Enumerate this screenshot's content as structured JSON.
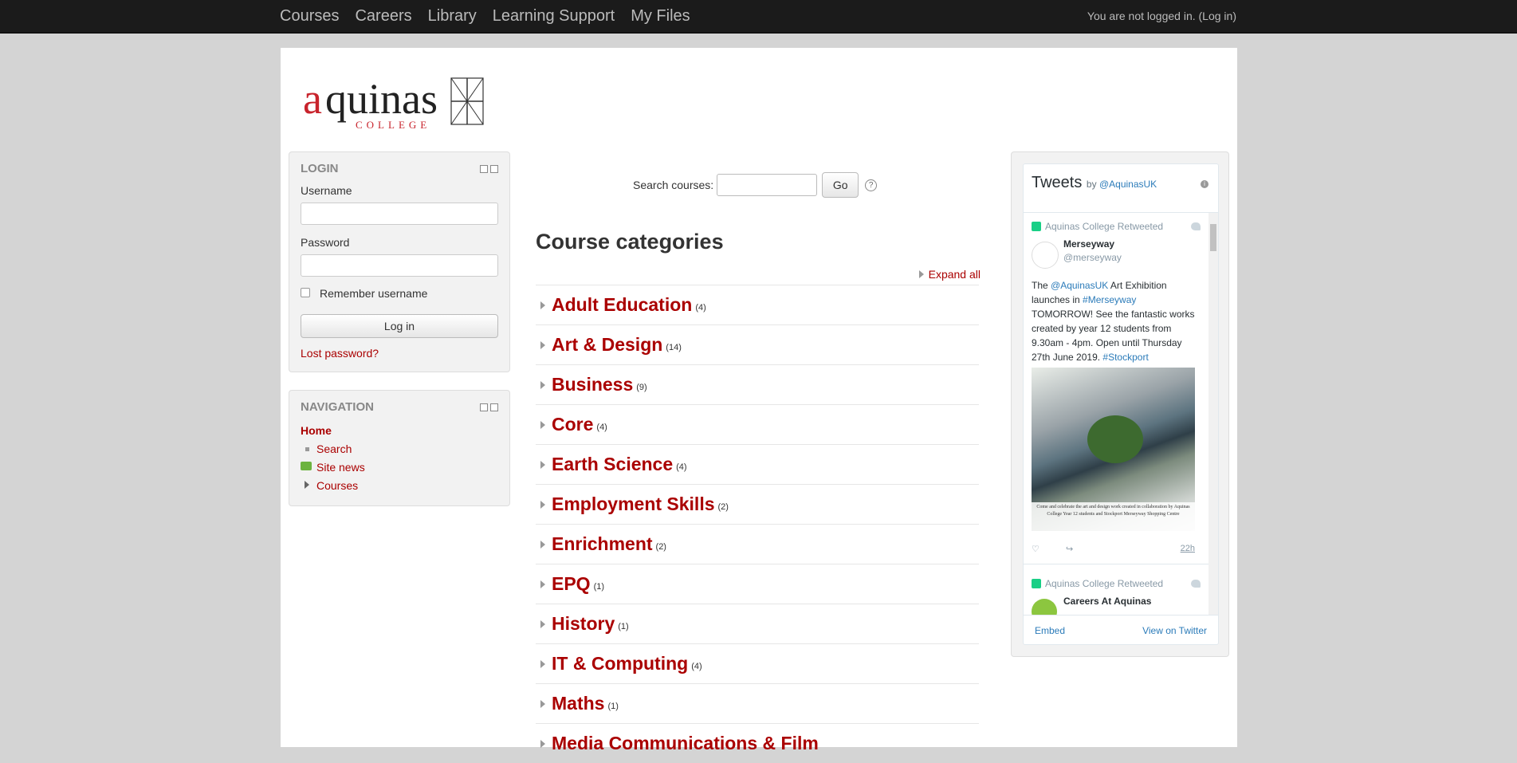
{
  "topnav": {
    "items": [
      "Courses",
      "Careers",
      "Library",
      "Learning Support",
      "My Files"
    ],
    "login_status": "You are not logged in. (Log in)"
  },
  "logo": {
    "brand": "aquinas",
    "sub": "COLLEGE"
  },
  "login_block": {
    "title": "LOGIN",
    "username_label": "Username",
    "password_label": "Password",
    "remember_label": "Remember username",
    "login_button": "Log in",
    "lost_password": "Lost password?"
  },
  "nav_block": {
    "title": "NAVIGATION",
    "home": "Home",
    "items": [
      "Search",
      "Site news",
      "Courses"
    ]
  },
  "search": {
    "label": "Search courses:",
    "go": "Go",
    "help": "?"
  },
  "main": {
    "heading": "Course categories",
    "expand_all": "Expand all",
    "categories": [
      {
        "name": "Adult Education",
        "count": "(4)"
      },
      {
        "name": "Art & Design",
        "count": "(14)"
      },
      {
        "name": "Business",
        "count": "(9)"
      },
      {
        "name": "Core",
        "count": "(4)"
      },
      {
        "name": "Earth Science",
        "count": "(4)"
      },
      {
        "name": "Employment Skills",
        "count": "(2)"
      },
      {
        "name": "Enrichment",
        "count": "(2)"
      },
      {
        "name": "EPQ",
        "count": "(1)"
      },
      {
        "name": "History",
        "count": "(1)"
      },
      {
        "name": "IT & Computing",
        "count": "(4)"
      },
      {
        "name": "Maths",
        "count": "(1)"
      },
      {
        "name": "Media Communications & Film",
        "count": ""
      }
    ]
  },
  "twitter": {
    "title": "Tweets",
    "by": "by",
    "handle": "@AquinasUK",
    "info": "i",
    "tweet1": {
      "retweeted": "Aquinas College Retweeted",
      "name": "Merseyway",
      "handle": "@merseyway",
      "text_a": "The ",
      "mention": "@AquinasUK",
      "text_b": " Art Exhibition launches in ",
      "tag1": "#Merseyway",
      "text_c": " TOMORROW! See the fantastic works created by year 12 students from 9.30am - 4pm. Open until Thursday 27th June 2019. ",
      "tag2": "#Stockport",
      "image_caption": "Come and celebrate the art and design work created in collaboration by Aquinas College Year 12 students and Stockport Merseyway Shopping Centre",
      "time": "22h"
    },
    "tweet2": {
      "retweeted": "Aquinas College Retweeted",
      "name": "Careers At Aquinas"
    },
    "embed": "Embed",
    "view_on": "View on Twitter"
  },
  "colors": {
    "accent": "#a00000",
    "topbar": "#1b1b1b",
    "twitter_link": "#2b7bb9"
  }
}
